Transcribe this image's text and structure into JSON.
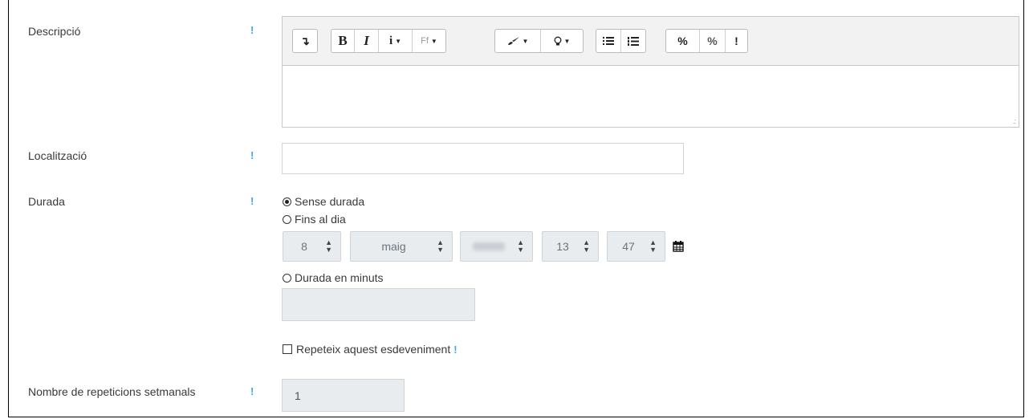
{
  "fields": {
    "description": {
      "label": "Descripció",
      "help": "!"
    },
    "location": {
      "label": "Localització",
      "help": "!",
      "value": ""
    },
    "duration": {
      "label": "Durada",
      "help": "!",
      "options": {
        "no_duration": "Sense durada",
        "until_day": "Fins al dia",
        "duration_minutes": "Durada en minuts"
      },
      "selected": "no_duration",
      "date": {
        "day": "8",
        "month": "maig",
        "year": "",
        "hour": "13",
        "minute": "47"
      },
      "minutes_value": ""
    },
    "repeat": {
      "label": "Repeteix aquest esdeveniment",
      "help": "!",
      "checked": false
    },
    "weekly_repeats": {
      "label": "Nombre de repeticions setmanals",
      "help": "!",
      "value": "1"
    }
  },
  "editor": {
    "toolbar": {
      "collapse": "↴",
      "bold": "B",
      "italic": "I",
      "info": "i",
      "font": "Ff",
      "link": "%",
      "unlink": "%",
      "accessibility": "!"
    },
    "content": ""
  },
  "icons": {
    "paintbrush": "paintbrush-icon",
    "lightbulb": "lightbulb-icon",
    "bullet_list": "bullet-list-icon",
    "numbered_list": "numbered-list-icon",
    "calendar": "calendar-icon"
  },
  "colors": {
    "help": "#3ea8e5",
    "disabled_bg": "#e9ecef"
  }
}
